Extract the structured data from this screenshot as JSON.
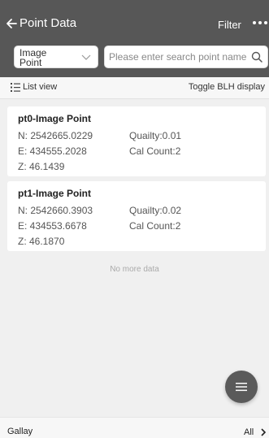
{
  "header": {
    "title": "Point Data",
    "filter_label": "Filter",
    "type_select": {
      "value": "Image Point"
    },
    "search": {
      "placeholder": "Please enter search point name"
    }
  },
  "subbar": {
    "list_view_label": "List view",
    "toggle_label": "Toggle BLH display"
  },
  "points": [
    {
      "name": "pt0-Image Point",
      "n": "N: 2542665.0229",
      "e": "E: 434555.2028",
      "z": "Z: 46.1439",
      "quality": "Quailty:0.01",
      "cal_count": "Cal Count:2"
    },
    {
      "name": "pt1-Image Point",
      "n": "N: 2542660.3903",
      "e": "E: 434553.6678",
      "z": "Z: 46.1870",
      "quality": "Quailty:0.02",
      "cal_count": "Cal Count:2"
    }
  ],
  "no_more_text": "No more data",
  "footer": {
    "gallery_label": "Gallay",
    "all_label": "All"
  },
  "colors": {
    "header_bg": "#575757",
    "fab_bg": "#5a5a5a",
    "page_bg": "#f0f0f0"
  },
  "icons": [
    "back-arrow-icon",
    "more-icon",
    "chevron-down-icon",
    "search-icon",
    "list-view-icon",
    "menu-icon",
    "chevron-right-icon"
  ]
}
